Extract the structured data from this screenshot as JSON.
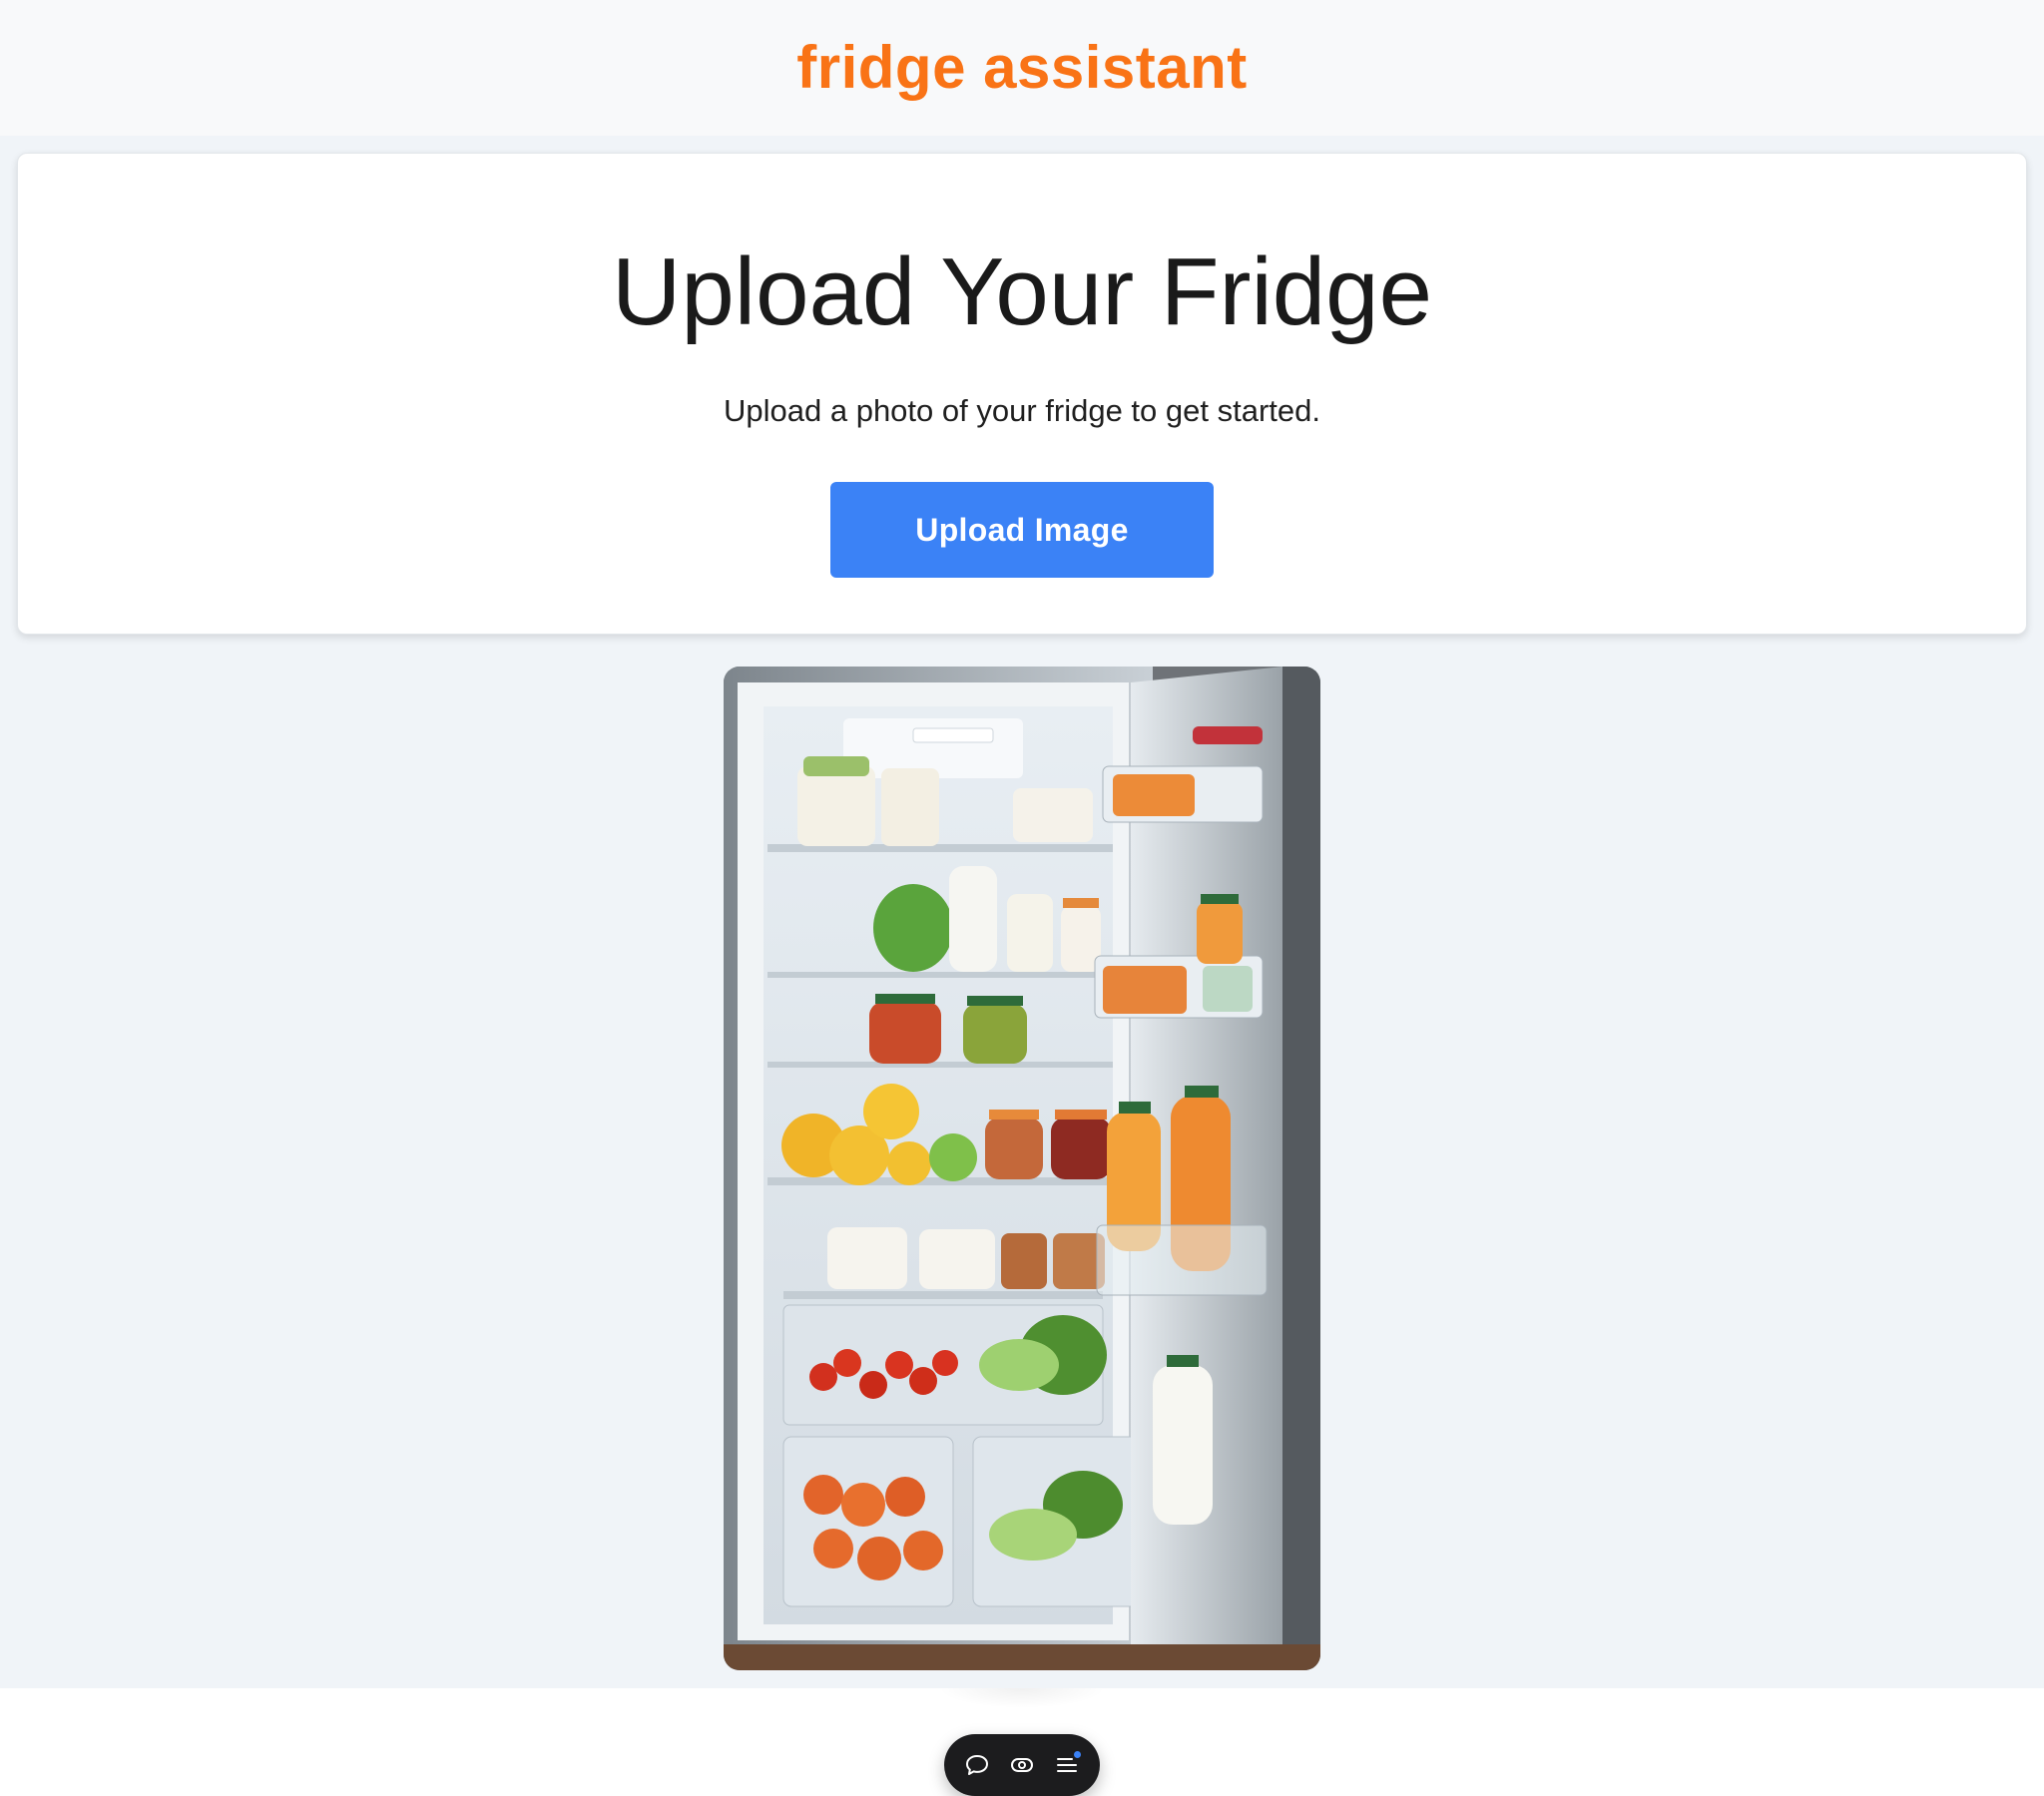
{
  "header": {
    "brand": "fridge assistant"
  },
  "upload_card": {
    "title": "Upload Your Fridge",
    "subtitle": "Upload a photo of your fridge to get started.",
    "button_label": "Upload Image"
  },
  "preview": {
    "alt": "Open refrigerator full of food"
  },
  "toolbar": {
    "icons": [
      "chat-bubble-icon",
      "eye-icon",
      "menu-list-icon"
    ]
  },
  "colors": {
    "brand": "#f97316",
    "button": "#3b82f6",
    "page_bg": "#f0f4f8",
    "header_bg": "#f8f9fa"
  }
}
